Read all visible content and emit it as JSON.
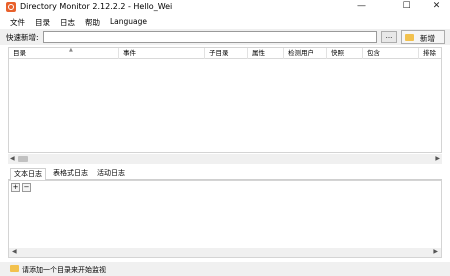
{
  "window": {
    "title": "Directory Monitor 2.12.2.2 - Hello_Wei",
    "minimize": "—",
    "maximize": "☐",
    "close": "✕"
  },
  "menu": {
    "items": [
      "文件",
      "目录",
      "日志",
      "帮助",
      "Language"
    ]
  },
  "quick_add": {
    "label": "快速新增:",
    "input_value": "",
    "browse_label": "...",
    "add_label": "新增"
  },
  "grid": {
    "columns": [
      "目录",
      "事件",
      "子目录",
      "属性",
      "检测用户",
      "快照",
      "包含",
      "排除"
    ]
  },
  "tabs": {
    "items": [
      "文本日志",
      "表格式日志",
      "活动日志"
    ]
  },
  "log_toolbar": {
    "expand": "+",
    "collapse": "−"
  },
  "status": {
    "text": "请添加一个目录来开始监视"
  },
  "colors": {
    "app_icon": "#e8612c",
    "folder": "#f2c14e"
  }
}
